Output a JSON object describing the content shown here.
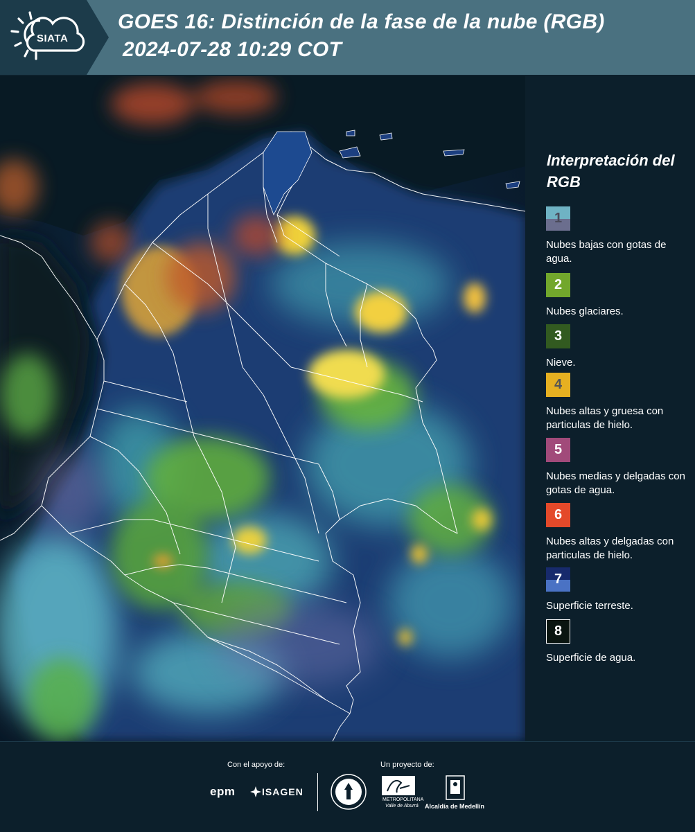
{
  "header": {
    "title_line1": "GOES 16: Distinción de la fase de la nube (RGB)",
    "title_line2": "2024-07-28 10:29 COT",
    "logo_text": "SIATA"
  },
  "legend": {
    "title": "Interpretación del RGB",
    "items": [
      {
        "number": "1",
        "label": "Nubes bajas con gotas de agua.",
        "color_top": "#6fb3c4",
        "color_bottom": "#6b6e8e",
        "number_color": "#4a4a5a"
      },
      {
        "number": "2",
        "label": "Nubes glaciares.",
        "color_top": "#72a72c",
        "color_bottom": "#72a72c",
        "number_color": "#ffffff"
      },
      {
        "number": "3",
        "label": "Nieve.",
        "color_top": "#325a20",
        "color_bottom": "#325a20",
        "number_color": "#ffffff"
      },
      {
        "number": "4",
        "label": "Nubes altas y gruesa con particulas de hielo.",
        "color_top": "#e6b021",
        "color_bottom": "#e6b021",
        "number_color": "#555555"
      },
      {
        "number": "5",
        "label": "Nubes medias y delgadas con gotas de agua.",
        "color_top": "#a14a7a",
        "color_bottom": "#a14a7a",
        "number_color": "#ffffff"
      },
      {
        "number": "6",
        "label": "Nubes altas y delgadas con particulas de hielo.",
        "color_top": "#e4492a",
        "color_bottom": "#e4492a",
        "number_color": "#ffffff"
      },
      {
        "number": "7",
        "label": "Superficie terreste.",
        "color_top": "#172a6c",
        "color_bottom": "#4a72c4",
        "number_color": "#ffffff"
      },
      {
        "number": "8",
        "label": "Superficie de agua.",
        "color_top": "#0a1510",
        "color_bottom": "#0a1510",
        "number_color": "#ffffff"
      }
    ]
  },
  "footer": {
    "support_label": "Con el apoyo de:",
    "project_label": "Un proyecto de:",
    "sponsor1": "epm",
    "sponsor2": "ISAGEN",
    "partner1_line1": "METROPOLITANA",
    "partner1_line2": "Valle de Aburrá",
    "partner2": "Alcaldía de Medellín"
  },
  "colors": {
    "header_bg": "#4a7180",
    "logo_panel_bg": "#1c3b4a",
    "page_bg": "#0c1f2b"
  }
}
